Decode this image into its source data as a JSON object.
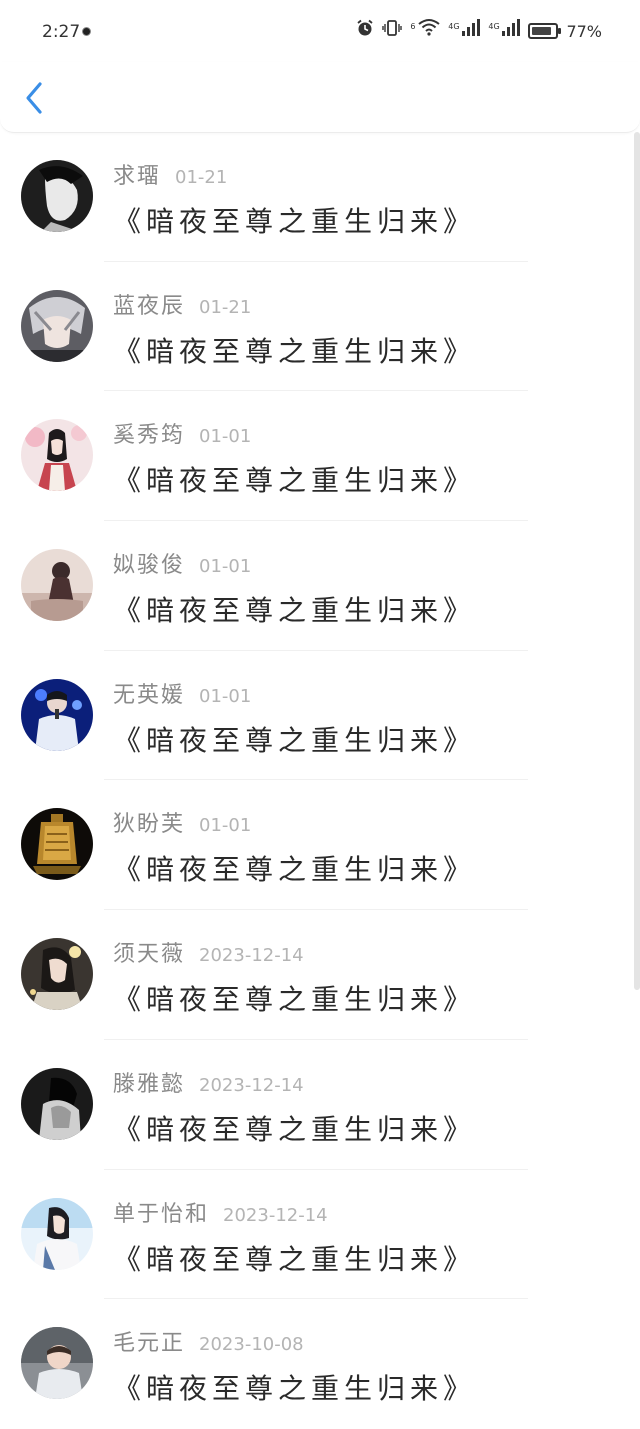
{
  "status_bar": {
    "time": "2:27",
    "network_1": "4G",
    "network_2": "4G",
    "wifi_badge": "6",
    "battery_percent": "77%",
    "icons": [
      "alarm-icon",
      "vibrate-icon",
      "wifi-icon",
      "signal-icon",
      "signal-icon",
      "battery-icon"
    ]
  },
  "nav": {
    "back_icon": "chevron-left-icon",
    "accent_color": "#3a8ee6"
  },
  "comments": [
    {
      "name": "求璢",
      "date": "01-21",
      "text": "《暗夜至尊之重生归来》"
    },
    {
      "name": "蓝夜辰",
      "date": "01-21",
      "text": "《暗夜至尊之重生归来》"
    },
    {
      "name": "奚秀筠",
      "date": "01-01",
      "text": "《暗夜至尊之重生归来》"
    },
    {
      "name": "姒骏俊",
      "date": "01-01",
      "text": "《暗夜至尊之重生归来》"
    },
    {
      "name": "无英媛",
      "date": "01-01",
      "text": "《暗夜至尊之重生归来》"
    },
    {
      "name": "狄盼芙",
      "date": "01-01",
      "text": "《暗夜至尊之重生归来》"
    },
    {
      "name": "须天薇",
      "date": "2023-12-14",
      "text": "《暗夜至尊之重生归来》"
    },
    {
      "name": "滕雅懿",
      "date": "2023-12-14",
      "text": "《暗夜至尊之重生归来》"
    },
    {
      "name": "单于怡和",
      "date": "2023-12-14",
      "text": "《暗夜至尊之重生归来》"
    },
    {
      "name": "毛元正",
      "date": "2023-10-08",
      "text": "《暗夜至尊之重生归来》"
    }
  ]
}
